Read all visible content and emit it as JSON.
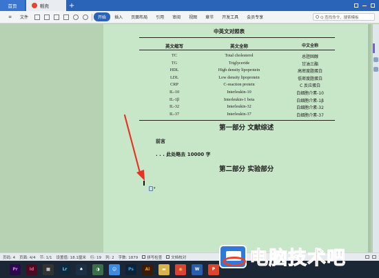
{
  "tabs": {
    "home": "首页",
    "document": "稻壳",
    "add": "+"
  },
  "menu": {
    "file": "文件",
    "items": [
      "开始",
      "插入",
      "页面布局",
      "引用",
      "审阅",
      "视图",
      "章节",
      "开发工具",
      "会员专享"
    ],
    "active_index": 0,
    "search_placeholder": "Q 查找命令、搜索模板"
  },
  "document": {
    "table_title": "中英文对照表",
    "headers": {
      "abbr": "英文缩写",
      "full": "英文全称",
      "cn": "中文全称"
    },
    "rows": [
      {
        "abbr": "TC",
        "full": "Total cholesterol",
        "cn": "总胆固醇"
      },
      {
        "abbr": "TG",
        "full": "Triglyceride",
        "cn": "甘油三酯"
      },
      {
        "abbr": "HDL",
        "full": "High density lipoprotein",
        "cn": "高密度脂蛋白"
      },
      {
        "abbr": "LDL",
        "full": "Low density lipoprotein",
        "cn": "低密度脂蛋白"
      },
      {
        "abbr": "CRP",
        "full": "C-reaction protein",
        "cn": "C 反应蛋白"
      },
      {
        "abbr": "IL-10",
        "full": "Interleukin-10",
        "cn": "白细胞介素-10"
      },
      {
        "abbr": "IL-1β",
        "full": "Interleukin-1 beta",
        "cn": "白细胞介素-1β"
      },
      {
        "abbr": "IL-32",
        "full": "Interleukin-32",
        "cn": "白细胞介素-32"
      },
      {
        "abbr": "IL-37",
        "full": "Interleukin-37",
        "cn": "白细胞介素-37"
      }
    ],
    "heading1": "第一部分  文献综述",
    "preface": "前言",
    "omitted": ". . . 此处略去 10000 字",
    "heading2": "第二部分  实验部分",
    "paste_dropdown": "▾"
  },
  "status": {
    "page_num": "页码: 4",
    "pages": "页面: 4/4",
    "section": "节: 1/1",
    "position": "设置值: 18.1厘米",
    "row": "行: 19",
    "col": "列: 2",
    "words": "字数: 1879",
    "spellcheck": "拼写检查",
    "doc_check": "文档校对"
  },
  "taskbar": {
    "apps": [
      {
        "name": "premiere",
        "label": "Pr",
        "color": "#2a0a4a",
        "fg": "#e07bff"
      },
      {
        "name": "indesign",
        "label": "Id",
        "color": "#4a0a22",
        "fg": "#ff5b8b"
      },
      {
        "name": "media-player",
        "label": "▦",
        "color": "#333333",
        "fg": "#ffffff"
      },
      {
        "name": "lightroom",
        "label": "Lr",
        "color": "#0d2a3d",
        "fg": "#6bc8ff"
      },
      {
        "name": "qq",
        "label": "♠",
        "color": "#1b2f45",
        "fg": "#ffffff"
      },
      {
        "name": "chat",
        "label": "◑",
        "color": "#3b6e4a",
        "fg": "#ffffff"
      },
      {
        "name": "finder",
        "label": "☺",
        "color": "#3c8be0",
        "fg": "#ffffff"
      },
      {
        "name": "photoshop",
        "label": "Ps",
        "color": "#0c2337",
        "fg": "#31a8ff"
      },
      {
        "name": "illustrator",
        "label": "Ai",
        "color": "#3a1c05",
        "fg": "#ff9a00"
      },
      {
        "name": "folder",
        "label": "▬",
        "color": "#d9b24a",
        "fg": "#ffffff"
      },
      {
        "name": "chrome",
        "label": "◉",
        "color": "#d84535",
        "fg": "#ffd23f"
      },
      {
        "name": "wps-writer",
        "label": "W",
        "color": "#2a5db0",
        "fg": "#ffffff"
      },
      {
        "name": "wps-ppt",
        "label": "P",
        "color": "#d9472b",
        "fg": "#ffffff"
      }
    ]
  },
  "watermark": {
    "text": "电脑技术吧"
  },
  "colors": {
    "accent": "#2a64b8",
    "page": "#c8e6c8",
    "arrow": "#e53324"
  }
}
